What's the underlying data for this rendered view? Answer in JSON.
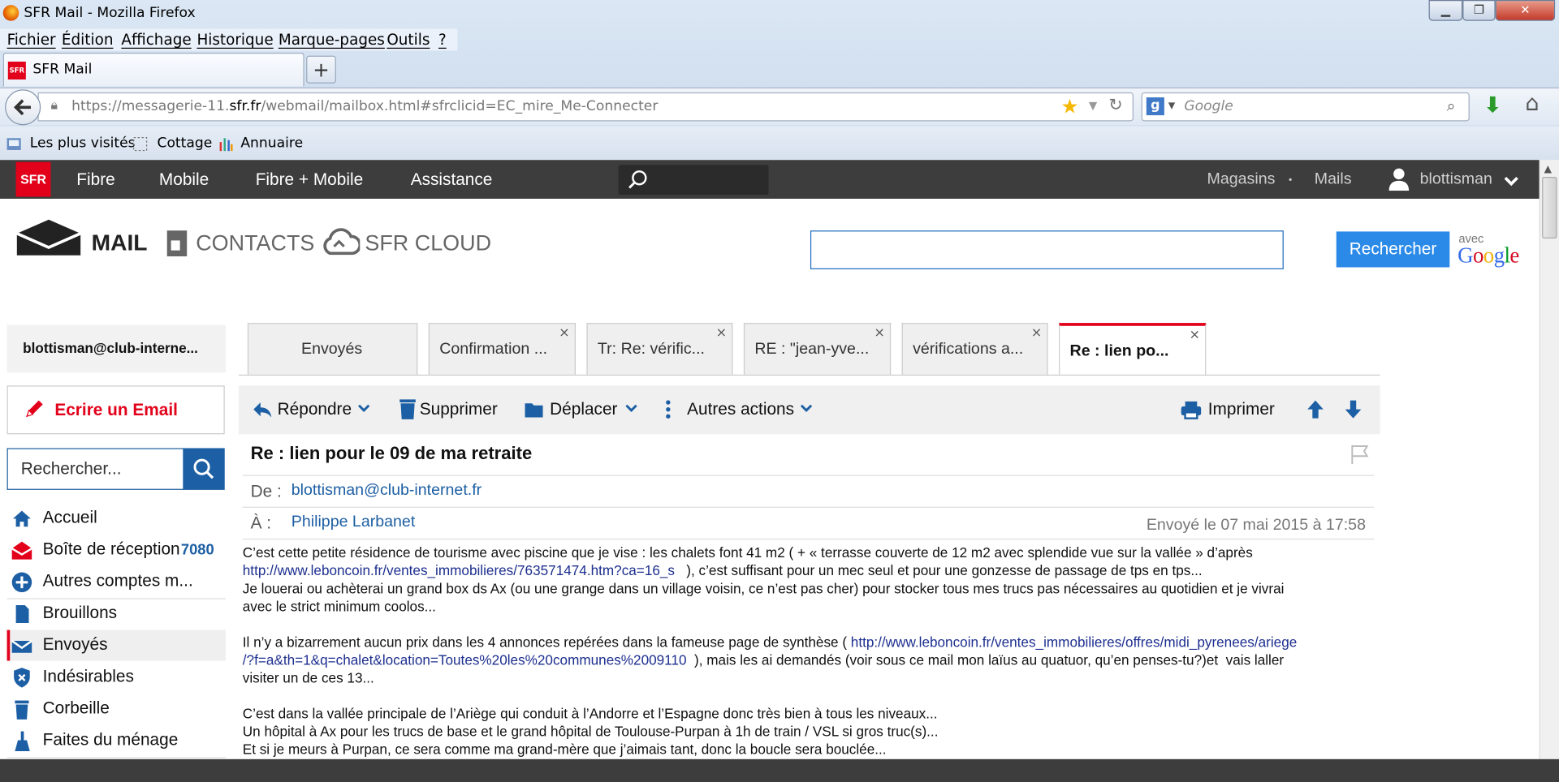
{
  "browser": {
    "window_title": "SFR Mail - Mozilla Firefox",
    "menu": [
      "Fichier",
      "Édition",
      "Affichage",
      "Historique",
      "Marque-pages",
      "Outils",
      "?"
    ],
    "tab_title": "SFR Mail",
    "new_tab": "+",
    "url_prefix": "https://messagerie-11.",
    "url_domain": "sfr.fr",
    "url_suffix": "/webmail/mailbox.html#sfrclicid=EC_mire_Me-Connecter",
    "search_engine_placeholder": "Google",
    "bookmarks": [
      "Les plus visités",
      "Cottage",
      "Annuaire"
    ]
  },
  "sfr_nav": {
    "logo": "SFR",
    "links": [
      "Fibre",
      "Mobile",
      "Fibre + Mobile",
      "Assistance"
    ],
    "right_links": [
      "Magasins",
      "Mails"
    ],
    "dot": "•",
    "user": "blottisman"
  },
  "apps": {
    "mail": "MAIL",
    "contacts": "CONTACTS",
    "cloud": "SFR CLOUD",
    "search_button": "Rechercher",
    "avec": "avec",
    "google": [
      "G",
      "o",
      "o",
      "g",
      "l",
      "e"
    ],
    "google_colors": [
      "#3369e8",
      "#d50f25",
      "#eeb211",
      "#3369e8",
      "#009925",
      "#d50f25"
    ]
  },
  "sidebar": {
    "account": "blottisman@club-interne...",
    "compose": "Ecrire un Email",
    "search_placeholder": "Rechercher...",
    "folders": [
      {
        "label": "Accueil",
        "icon": "home-icon"
      },
      {
        "label": "Boîte de réception",
        "count": "7080",
        "icon": "inbox-icon"
      },
      {
        "label": "Autres comptes m...",
        "icon": "plus-circle-icon"
      },
      {
        "label": "Brouillons",
        "icon": "draft-icon"
      },
      {
        "label": "Envoyés",
        "icon": "sent-icon"
      },
      {
        "label": "Indésirables",
        "icon": "shield-icon"
      },
      {
        "label": "Corbeille",
        "icon": "trash-icon"
      },
      {
        "label": "Faites du ménage",
        "icon": "broom-icon"
      }
    ]
  },
  "message_tabs": [
    {
      "label": "Envoyés"
    },
    {
      "label": "Confirmation ...",
      "close": "×"
    },
    {
      "label": "Tr: Re: vérific...",
      "close": "×"
    },
    {
      "label": "RE : \"jean-yve...",
      "close": "×"
    },
    {
      "label": "vérifications a...",
      "close": "×"
    },
    {
      "label": "Re : lien po...",
      "close": "×"
    }
  ],
  "toolbar": {
    "reply": "Répondre",
    "delete": "Supprimer",
    "move": "Déplacer",
    "more": "Autres actions",
    "print": "Imprimer"
  },
  "message": {
    "subject": "Re : lien pour le 09 de ma retraite",
    "from_label": "De :",
    "from": "blottisman@club-internet.fr",
    "to_label": "À :",
    "to": "Philippe Larbanet",
    "sent": "Envoyé le 07 mai 2015 à 17:58",
    "body": {
      "l1": "C’est cette petite résidence de tourisme avec piscine que je vise : les chalets font 41 m2 ( + « terrasse couverte de 12 m2 avec splendide vue sur la vallée » d’après",
      "link1": "http://www.leboncoin.fr/ventes_immobilieres/763571474.htm?ca=16_s",
      "l2": "   ), c’est suffisant pour un mec seul et pour une gonzesse de passage de tps en tps...",
      "l3": "Je louerai ou achèterai un grand box ds Ax (ou une grange dans un village voisin, ce n’est pas cher) pour stocker tous mes trucs pas nécessaires au quotidien et je vivrai",
      "l4": "avec le strict minimum coolos...",
      "l5": "Il n’y a bizarrement aucun prix dans les 4 annonces repérées dans la fameuse page de synthèse ( ",
      "link2a": "http://www.leboncoin.fr/ventes_immobilieres/offres/midi_pyrenees/ariege",
      "link2b": "/?f=a&th=1&q=chalet&location=Toutes%20les%20communes%2009110",
      "l6": "  ), mais les ai demandés (voir sous ce mail mon laïus au quatuor, qu’en penses-tu?)et  vais laller",
      "l7": "visiter un de ces 13...",
      "l8": "C’est dans la vallée principale de l’Ariège qui conduit à l’Andorre et l’Espagne donc très bien à tous les niveaux...",
      "l9": "Un hôpital à Ax pour les trucs de base et le grand hôpital de Toulouse-Purpan à 1h de train / VSL si gros truc(s)...",
      "l10": "Et si je meurs à Purpan, ce sera comme ma grand-mère que j’aimais tant, donc la boucle sera bouclée..."
    }
  },
  "colors": {
    "sfr_red": "#e2001a",
    "nav_dark": "#3d3d3d",
    "link_blue": "#1d5fa4",
    "button_blue": "#2b8ae8"
  }
}
